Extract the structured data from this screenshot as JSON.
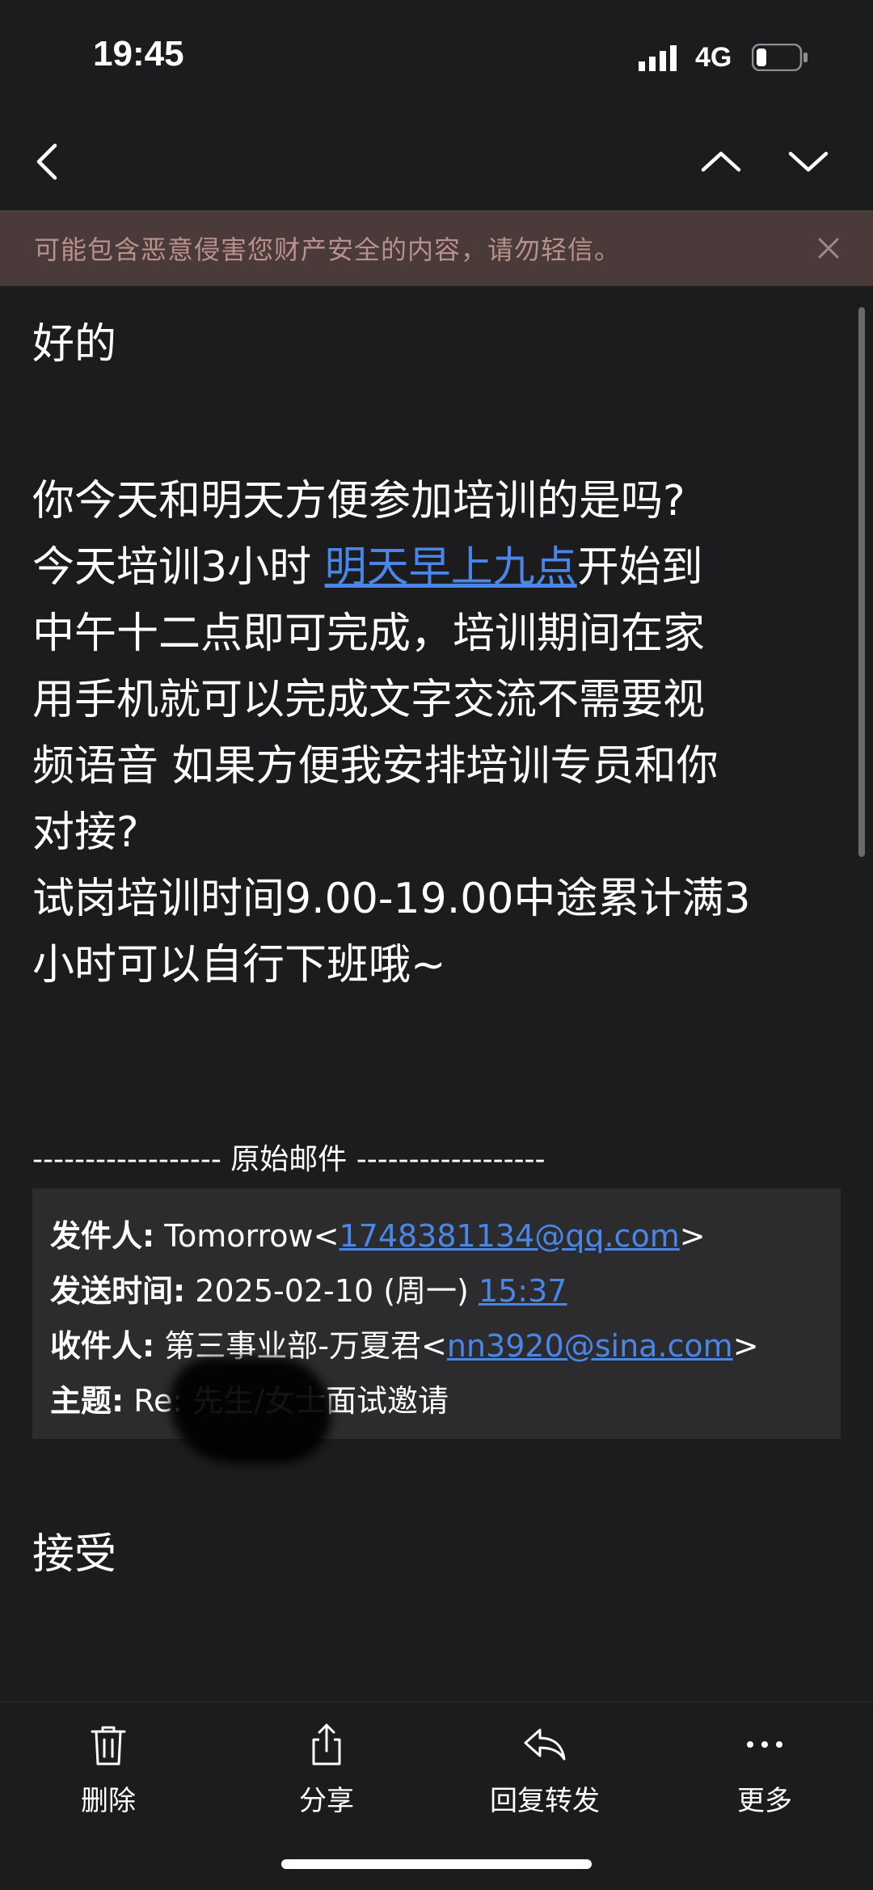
{
  "status_bar": {
    "time": "19:45",
    "network": "4G",
    "signal_icon": "cellular-signal-icon",
    "battery_icon": "battery-low-icon"
  },
  "nav": {
    "back_icon": "chevron-left-icon",
    "prev_icon": "chevron-up-icon",
    "next_icon": "chevron-down-icon"
  },
  "warning": {
    "text": "可能包含恶意侵害您财产安全的内容，请勿轻信。",
    "close_icon": "close-icon"
  },
  "email": {
    "line1": "好的",
    "p2_line1": "你今天和明天方便参加培训的是吗?",
    "p2_line2_pre": "今天培训3小时 ",
    "p2_line2_link": "明天早上九点",
    "p2_line2_post": "开始到",
    "p2_line3": "中午十二点即可完成，培训期间在家",
    "p2_line4": "用手机就可以完成文字交流不需要视",
    "p2_line5": "频语音 如果方便我安排培训专员和你",
    "p2_line6": "对接?",
    "p2_line7": "试岗培训时间9.00-19.00中途累计满3",
    "p2_line8": "小时可以自行下班哦~"
  },
  "quoted": {
    "divider": "------------------ 原始邮件 ------------------",
    "from_label": "发件人:",
    "from_name": " Tomorrow<",
    "from_email": "1748381134@qq.com",
    "from_close": ">",
    "date_label": "发送时间:",
    "date_value": " 2025-02-10 (周一) ",
    "date_time": "15:37",
    "to_label": "收件人:",
    "to_name": " 第三事业部-万夏君<",
    "to_email": "nn3920@sina.com",
    "to_close": ">",
    "subject_label": "主题:",
    "subject_value": " Re:      先生/女士面试邀请"
  },
  "accept": "接受",
  "toolbar": {
    "items": [
      {
        "label": "删除",
        "icon": "trash-icon"
      },
      {
        "label": "分享",
        "icon": "share-icon"
      },
      {
        "label": "回复转发",
        "icon": "reply-icon"
      },
      {
        "label": "更多",
        "icon": "more-icon"
      }
    ]
  },
  "colors": {
    "background": "#1c1c1e",
    "warning_bg": "#4a3a39",
    "warning_text": "#b8918c",
    "link": "#4a86e8"
  }
}
